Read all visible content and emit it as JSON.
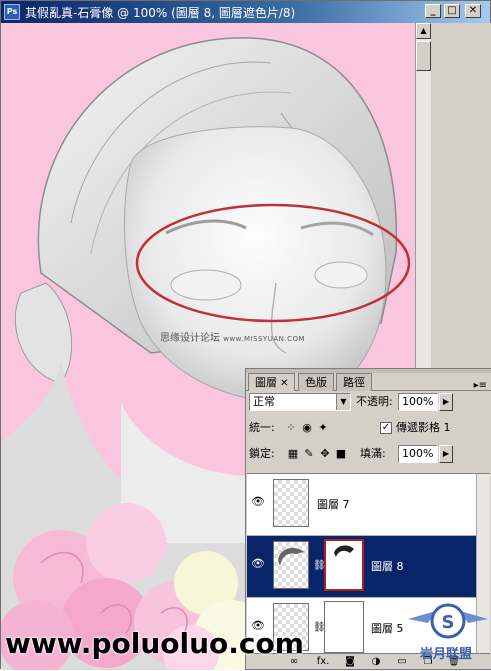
{
  "window": {
    "title": "其假亂真-石膏像 @ 100% (圖層 8, 圖層遮色片/8)",
    "icon_label": "Ps",
    "buttons": {
      "minimize": "_",
      "maximize": "□",
      "close": "✕"
    }
  },
  "canvas": {
    "background": "#f9c6dd",
    "credit_text": "思缘设计论坛",
    "credit_url": "www.MISSYUAN.COM",
    "watermark": "www.poluoluo.com",
    "logo_text": "岩月联盟"
  },
  "layers_panel": {
    "tabs": [
      {
        "label": "圖層",
        "active": true,
        "close": "✕"
      },
      {
        "label": "色版",
        "active": false
      },
      {
        "label": "路徑",
        "active": false
      }
    ],
    "menu_icon": "▸≡",
    "blend_mode": "正常",
    "opacity_label": "不透明:",
    "opacity_value": "100%",
    "unify_label": "統一:",
    "propagate_label": "傳遞影格 1",
    "propagate_checked": true,
    "lock_label": "鎖定:",
    "fill_label": "填滿:",
    "fill_value": "100%",
    "layers": [
      {
        "name": "圖層 7",
        "selected": false,
        "has_mask": false
      },
      {
        "name": "圖層 8",
        "selected": true,
        "has_mask": true
      },
      {
        "name": "圖層 5",
        "selected": false,
        "has_mask": true
      }
    ],
    "bottom_icons": [
      "link-icon",
      "fx-icon",
      "mask-icon",
      "adjustment-icon",
      "folder-icon",
      "new-layer-icon",
      "trash-icon"
    ],
    "fx_label": "fx."
  },
  "colors": {
    "selection_blue": "#0a246a",
    "ellipse_red": "#c0303a"
  }
}
